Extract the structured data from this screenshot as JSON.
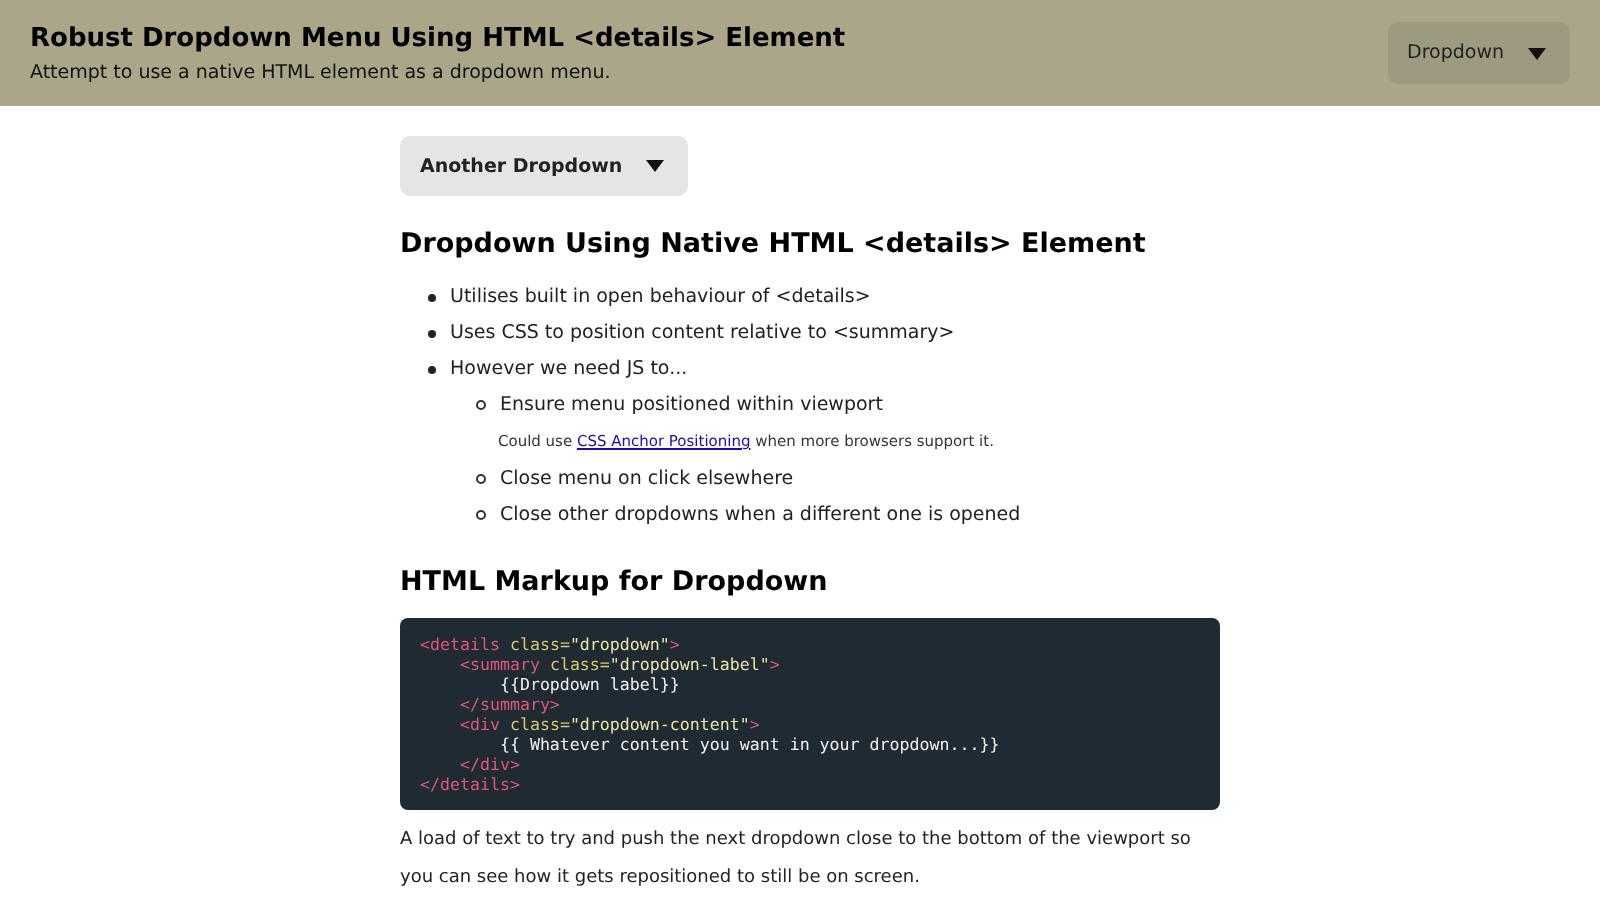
{
  "header": {
    "title": "Robust Dropdown Menu Using HTML <details> Element",
    "subtitle": "Attempt to use a native HTML element as a dropdown menu.",
    "dropdown": {
      "label": "Dropdown",
      "expanded": false
    }
  },
  "another_dropdown": {
    "label": "Another Dropdown",
    "expanded": false
  },
  "section_1": {
    "heading": "Dropdown Using Native HTML <details> Element",
    "items": [
      {
        "text": "Utilises built in open behaviour of <details>"
      },
      {
        "text": "Uses CSS to position content relative to <summary>"
      },
      {
        "text": "However we need JS to...",
        "children": [
          {
            "text": "Ensure menu positioned within viewport",
            "note": {
              "before": "Could use ",
              "link": "CSS Anchor Positioning",
              "after": " when more browsers support it."
            }
          },
          {
            "text": "Close menu on click elsewhere"
          },
          {
            "text": "Close other dropdowns when a different one is opened"
          }
        ]
      }
    ]
  },
  "section_2": {
    "heading": "HTML Markup for Dropdown",
    "code_lines": [
      [
        {
          "kind": "tag",
          "text": "<details"
        },
        {
          "kind": "attr",
          "text": " class="
        },
        {
          "kind": "str",
          "text": "\"dropdown\""
        },
        {
          "kind": "tag",
          "text": ">"
        }
      ],
      [
        {
          "kind": "tag",
          "text": "    <summary"
        },
        {
          "kind": "attr",
          "text": " class="
        },
        {
          "kind": "str",
          "text": "\"dropdown-label\""
        },
        {
          "kind": "tag",
          "text": ">"
        }
      ],
      [
        {
          "kind": "plain",
          "text": "        {{Dropdown label}}"
        }
      ],
      [
        {
          "kind": "tag",
          "text": "    </summary>"
        }
      ],
      [
        {
          "kind": "tag",
          "text": "    <div"
        },
        {
          "kind": "attr",
          "text": " class="
        },
        {
          "kind": "str",
          "text": "\"dropdown-content\""
        },
        {
          "kind": "tag",
          "text": ">"
        }
      ],
      [
        {
          "kind": "plain",
          "text": "        {{ Whatever content you want in your dropdown...}}"
        }
      ],
      [
        {
          "kind": "tag",
          "text": "    </div>"
        }
      ],
      [
        {
          "kind": "tag",
          "text": "</details>"
        }
      ]
    ],
    "paragraph": "A load of text to try and push the next dropdown close to the bottom of the viewport so you can see how it gets repositioned to still be on screen."
  }
}
